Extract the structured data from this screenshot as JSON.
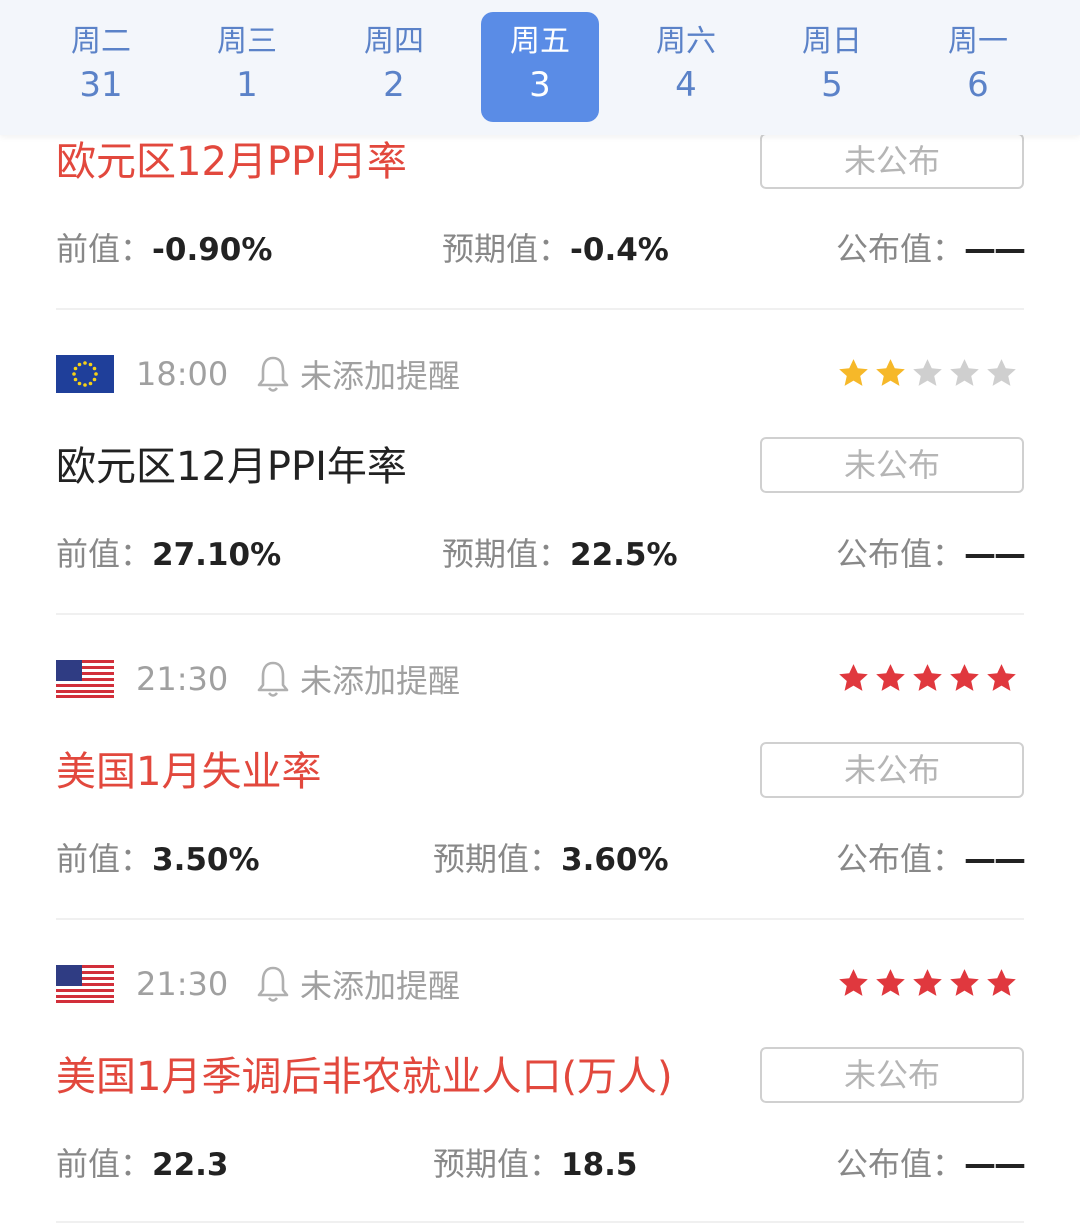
{
  "days": [
    {
      "weekday": "周二",
      "date": "31"
    },
    {
      "weekday": "周三",
      "date": "1"
    },
    {
      "weekday": "周四",
      "date": "2"
    },
    {
      "weekday": "周五",
      "date": "3"
    },
    {
      "weekday": "周六",
      "date": "4"
    },
    {
      "weekday": "周日",
      "date": "5"
    },
    {
      "weekday": "周一",
      "date": "6"
    }
  ],
  "selected_day_index": 3,
  "labels": {
    "prev": "前值：",
    "forecast": "预期值：",
    "actual": "公布值："
  },
  "events": [
    {
      "title": "欧元区12月PPI月率",
      "status": "未公布",
      "prev": "-0.90%",
      "forecast": "-0.4%",
      "actual": "——"
    },
    {
      "flag": "eu-flag-icon",
      "time": "18:00",
      "reminder": "未添加提醒",
      "stars": 2,
      "star_color": "#f6b829",
      "title": "欧元区12月PPI年率",
      "status": "未公布",
      "prev": "27.10%",
      "forecast": "22.5%",
      "actual": "——"
    },
    {
      "flag": "us-flag-icon",
      "time": "21:30",
      "reminder": "未添加提醒",
      "stars": 5,
      "star_color": "#e0383e",
      "title": "美国1月失业率",
      "status": "未公布",
      "prev": "3.50%",
      "forecast": "3.60%",
      "actual": "——"
    },
    {
      "flag": "us-flag-icon",
      "time": "21:30",
      "reminder": "未添加提醒",
      "stars": 5,
      "star_color": "#e0383e",
      "title": "美国1月季调后非农就业人口(万人)",
      "status": "未公布",
      "prev": "22.3",
      "forecast": "18.5",
      "actual": "——"
    }
  ],
  "colors": {
    "accent": "#5a8ce6",
    "title_important": "#e2483d",
    "star_empty": "#cfcfcf"
  }
}
